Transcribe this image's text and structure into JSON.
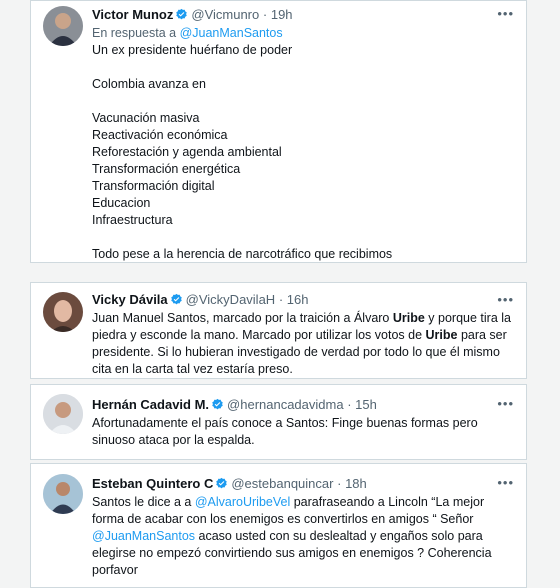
{
  "tweets": [
    {
      "name": "Victor Munoz",
      "handle": "@Vicmunro",
      "dot": "·",
      "time": "19h",
      "reply_prefix": "En respuesta a",
      "reply_to": "@JuanManSantos",
      "lines": [
        "Un ex presidente huérfano de poder",
        "",
        "Colombia avanza en",
        "",
        "Vacunación masiva",
        "Reactivación económica",
        "Reforestación y agenda ambiental",
        "Transformación energética",
        "Transformación digital",
        "Educacion",
        "Infraestructura",
        "",
        "Todo pese a la herencia de narcotráfico que recibimos"
      ]
    },
    {
      "name": "Vicky Dávila",
      "handle": "@VickyDavilaH",
      "dot": "·",
      "time": "16h",
      "text": {
        "p1": "Juan Manuel Santos, marcado por la traición a Álvaro ",
        "b1": "Uribe",
        "p2": " y porque tira la piedra y esconde la mano. Marcado por utilizar los votos de ",
        "b2": "Uribe",
        "p3": " para ser presidente. Si lo hubieran investigado de verdad por todo lo que él mismo cita en la carta tal vez estaría preso."
      }
    },
    {
      "name": "Hernán Cadavid M.",
      "handle": "@hernancadavidma",
      "dot": "·",
      "time": "15h",
      "text": "Afortunadamente el país conoce a Santos: Finge buenas formas pero sinuoso ataca por la espalda."
    },
    {
      "name": "Esteban Quintero C",
      "handle": "@estebanquincar",
      "dot": "·",
      "time": "18h",
      "text": {
        "p1": "Santos le dice a a ",
        "m1": "@AlvaroUribeVel",
        "p2": " parafraseando a Lincoln “La mejor forma de acabar con los enemigos es convertirlos en amigos “ Señor ",
        "m2": "@JuanManSantos",
        "p3": " acaso usted con su deslealtad y engaños solo para elegirse no empezó convirtiendo sus amigos en enemigos ? Coherencia porfavor"
      }
    }
  ],
  "more_icon": "more-horizontal-icon",
  "verified_icon": "verified-badge-icon",
  "colors": {
    "verified": "#1d9bf0",
    "mention": "#1d9bf0",
    "muted": "#536471"
  }
}
